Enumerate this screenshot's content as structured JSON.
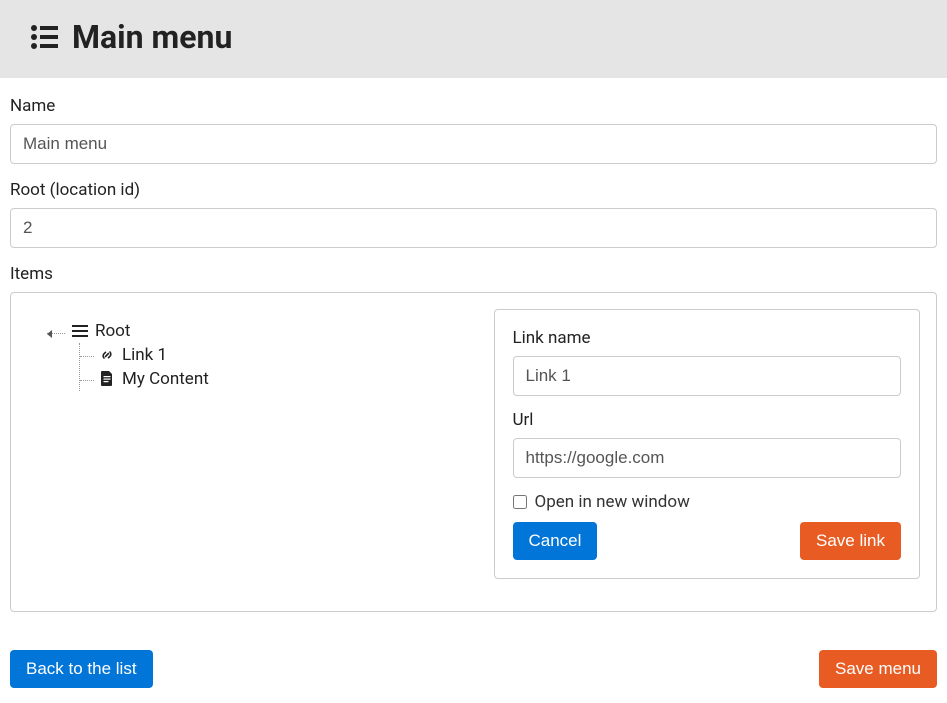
{
  "header": {
    "title": "Main menu"
  },
  "fields": {
    "name": {
      "label": "Name",
      "value": "Main menu"
    },
    "root": {
      "label": "Root (location id)",
      "value": "2"
    },
    "items": {
      "label": "Items"
    }
  },
  "tree": {
    "root": {
      "label": "Root"
    },
    "children": [
      {
        "label": "Link 1",
        "type": "link"
      },
      {
        "label": "My Content",
        "type": "content"
      }
    ]
  },
  "editor": {
    "link_name": {
      "label": "Link name",
      "value": "Link 1"
    },
    "url": {
      "label": "Url",
      "value": "https://google.com"
    },
    "open_new_window": {
      "label": "Open in new window",
      "checked": false
    },
    "cancel_label": "Cancel",
    "save_link_label": "Save link"
  },
  "footer": {
    "back_label": "Back to the list",
    "save_menu_label": "Save menu"
  }
}
